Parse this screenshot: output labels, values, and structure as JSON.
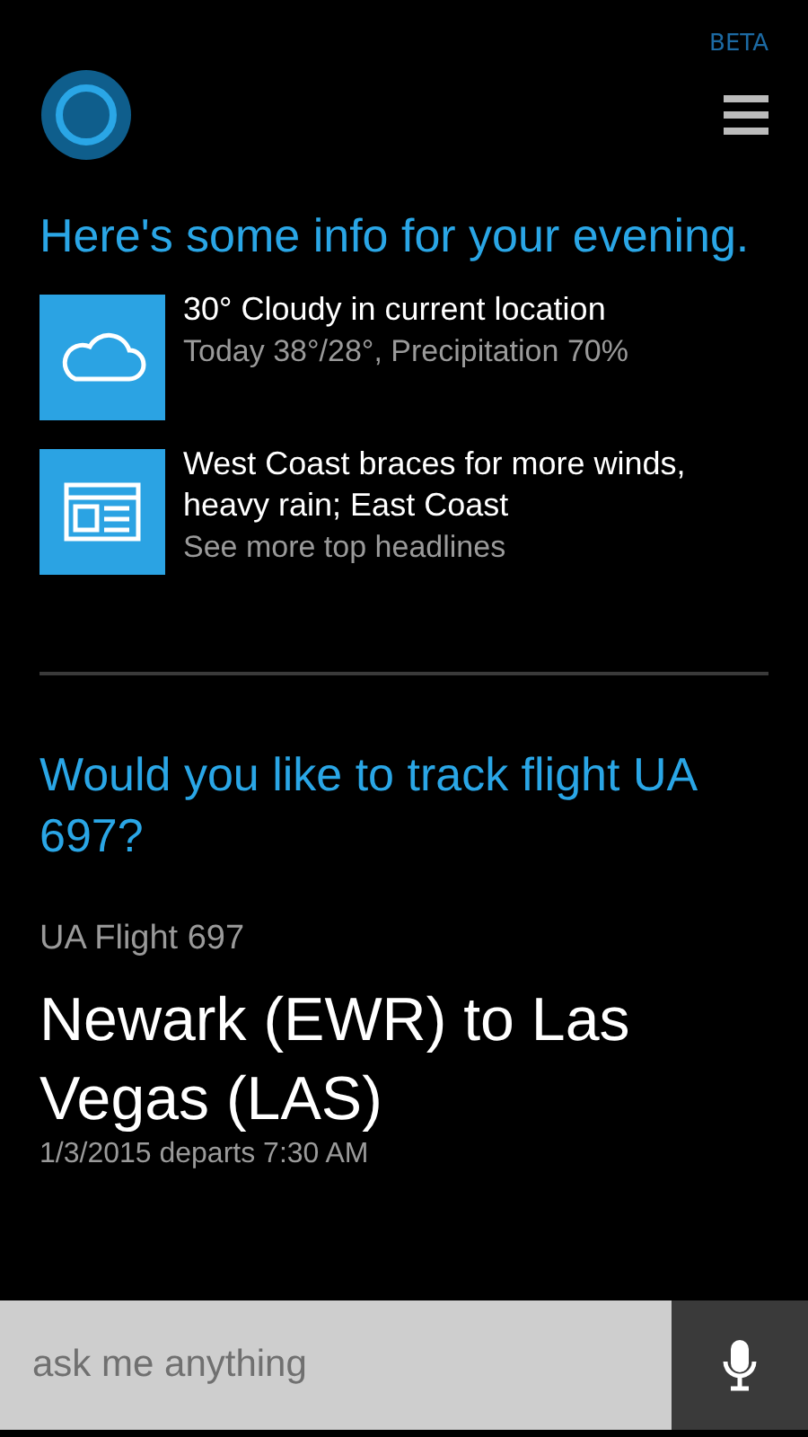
{
  "badge": "BETA",
  "greeting": "Here's some info for your evening.",
  "cards": [
    {
      "kind": "weather",
      "title": "30° Cloudy in current location",
      "subtitle": "Today 38°/28°, Precipitation 70%"
    },
    {
      "kind": "news",
      "title": "West Coast braces for more winds, heavy rain; East Coast",
      "subtitle": "See more top headlines"
    }
  ],
  "flight": {
    "question": "Would you like to track flight UA 697?",
    "label": "UA Flight 697",
    "route": "Newark (EWR) to Las Vegas (LAS)",
    "departs": "1/3/2015 departs 7:30 AM"
  },
  "search": {
    "placeholder": "ask me anything"
  }
}
